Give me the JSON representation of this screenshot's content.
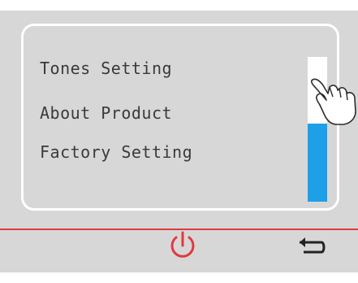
{
  "menu": {
    "items": [
      {
        "label": "Tones Setting"
      },
      {
        "label": "About Product"
      },
      {
        "label": "Factory Setting"
      }
    ]
  },
  "scrollbar": {
    "position_fraction": 0.53,
    "thumb_fraction": 0.54
  },
  "bottom_bar": {
    "power_icon": "power-icon",
    "back_icon": "return-arrow-icon"
  },
  "colors": {
    "screen_bg": "#d7d7d7",
    "panel_border": "#ffffff",
    "scroll_thumb": "#1ea0e8",
    "divider": "#e03a3e",
    "power_icon": "#e03a3e",
    "back_icon": "#222222"
  }
}
